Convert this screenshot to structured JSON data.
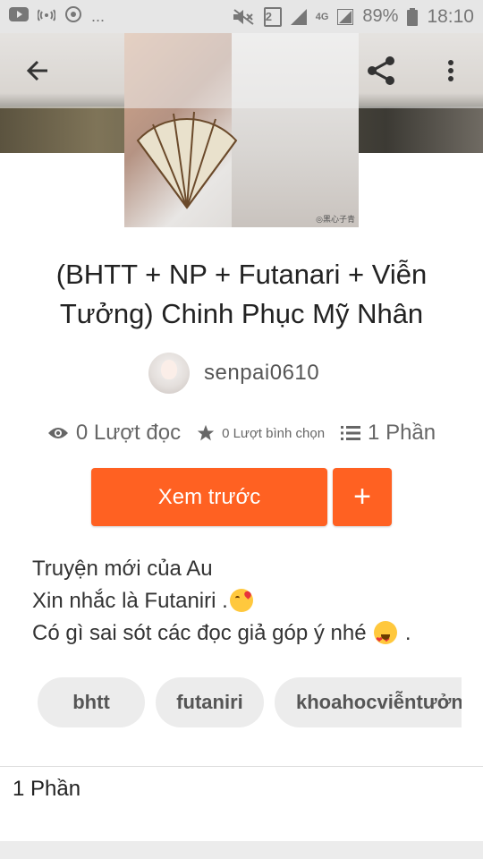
{
  "status_bar": {
    "battery_percent": "89%",
    "time": "18:10",
    "sim_slot": "2",
    "network_type": "4G",
    "more": "..."
  },
  "app_bar": {
    "back_icon": "arrow-back-icon",
    "share_icon": "share-icon",
    "menu_icon": "more-vert-icon"
  },
  "cover": {
    "watermark": "◎黑心子青"
  },
  "story": {
    "title": "(BHTT + NP + Futanari + Viễn Tưởng) Chinh Phục Mỹ Nhân",
    "author": "senpai0610"
  },
  "stats": {
    "reads": "0 Lượt đọc",
    "votes": "0 Lượt bình chọn",
    "parts": "1 Phần"
  },
  "actions": {
    "read_label": "Xem trước",
    "add_label": "+"
  },
  "description": {
    "line1": "Truyện mới của Au",
    "line2": "Xin nhắc là Futaniri .",
    "line3": "Có gì sai sót các đọc giả góp ý nhé ",
    "line3_end": "."
  },
  "tags": [
    "bhtt",
    "futaniri",
    "khoahocviễntưởng"
  ],
  "parts_section": {
    "label": "1 Phần"
  },
  "colors": {
    "accent": "#ff6122",
    "tag_bg": "#ececec",
    "status_bar_bg": "#e6e6e6"
  }
}
